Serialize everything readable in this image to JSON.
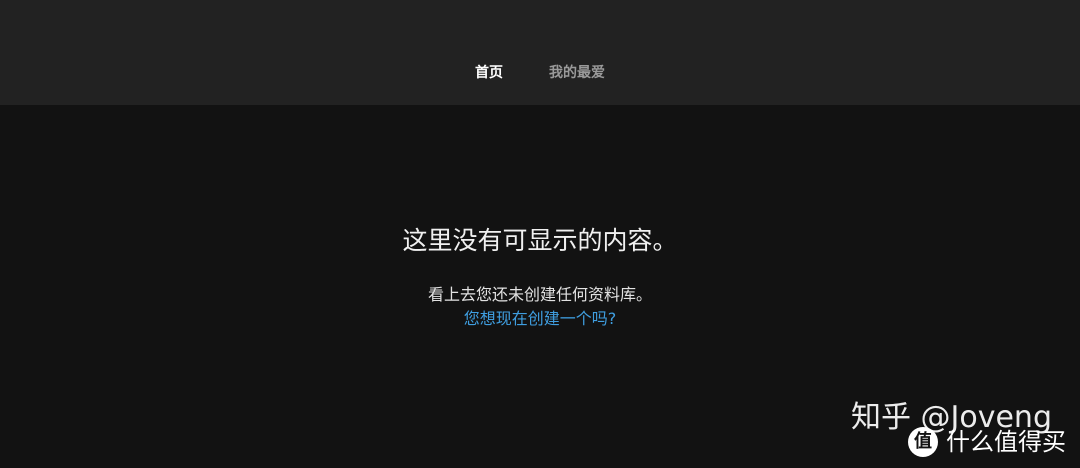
{
  "nav": {
    "tabs": [
      {
        "label": "首页",
        "active": true
      },
      {
        "label": "我的最爱",
        "active": false
      }
    ]
  },
  "empty_state": {
    "title": "这里没有可显示的内容。",
    "subtitle": "看上去您还未创建任何资料库。",
    "link": "您想现在创建一个吗?"
  },
  "watermark": {
    "zhihu": "知乎 @Joveng",
    "smzdm_logo": "值",
    "smzdm": "什么值得买"
  },
  "colors": {
    "background": "#121212",
    "topbar": "#222222",
    "link": "#3f9ee0"
  }
}
